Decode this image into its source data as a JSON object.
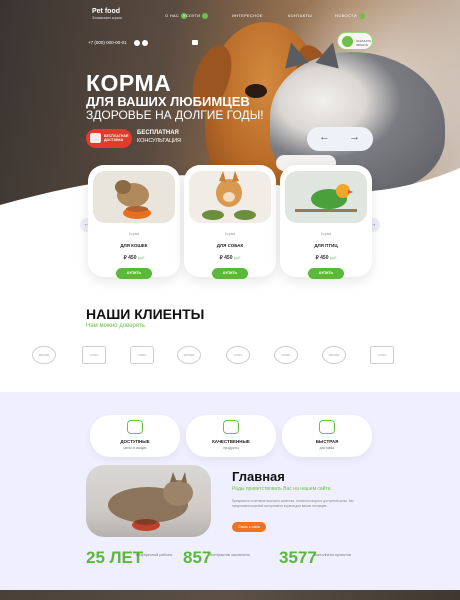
{
  "header": {
    "logo_title": "Pet food",
    "logo_sub": "Зоомагазин корма",
    "nav": [
      "О НАС",
      "УСЛУГИ",
      "ИНТЕРЕСНОЕ",
      "КОНТАКТЫ",
      "НОВОСТИ"
    ],
    "phone": "+7 (000) 000-00-01",
    "cart_label": "ЗАКАЗАТЬ ЗВОНОК"
  },
  "hero": {
    "title": "КОРМА",
    "subtitle": "ДЛЯ ВАШИХ ЛЮБИМЦЕВ",
    "tagline": "ЗДОРОВЬЕ НА ДОЛГИЕ ГОДЫ!",
    "badge_text": "БЕСПЛАТНАЯ ДОСТАВКА",
    "promo_title": "БЕСПЛАТНАЯ",
    "promo_sub": "КОНСУЛЬТАЦИЯ",
    "arrow_prev": "←",
    "arrow_next": "→"
  },
  "products": [
    {
      "brand": "Корма",
      "name": "ДЛЯ КОШЕК",
      "price": "450",
      "currency": "руб",
      "button": "КУПИТЬ"
    },
    {
      "brand": "Корма",
      "name": "ДЛЯ СОБАК",
      "price": "450",
      "currency": "руб",
      "button": "КУПИТЬ"
    },
    {
      "brand": "Корма",
      "name": "ДЛЯ ПТИЦ",
      "price": "450",
      "currency": "руб",
      "button": "КУПИТЬ"
    }
  ],
  "slider": {
    "prev": "←",
    "next": "→"
  },
  "clients": {
    "title": "НАШИ КЛИЕНТЫ",
    "subtitle": "Нам можно доверять",
    "logos": [
      "BRAND",
      "LOGO",
      "CORP",
      "BRAND",
      "LOGO",
      "FOOD",
      "BRAND",
      "LOGO"
    ]
  },
  "features": [
    {
      "title": "ДОСТУПНЫЕ",
      "sub": "цены и скидки"
    },
    {
      "title": "КАЧЕСТВЕННЫЕ",
      "sub": "продукты"
    },
    {
      "title": "БЫСТРАЯ",
      "sub": "доставка"
    }
  ],
  "about": {
    "title": "Главная",
    "subtitle": "Рады приветствовать Вас на нашем сайте.",
    "text": "Прекрасное сочетание высокого качества, отличного вкуса и доступной цены. Мы предлагаем широкий ассортимент кормов для ваших питомцев.",
    "button": "Связь с нами"
  },
  "stats": [
    {
      "value": "25 ЛЕТ",
      "label": "безупречной работы"
    },
    {
      "value": "857",
      "label": "Контрактов заключено"
    },
    {
      "value": "3577",
      "label": "Выполнено проектов"
    }
  ],
  "colors": {
    "accent_green": "#5cb83a",
    "accent_red": "#e8382c",
    "accent_orange": "#ee7322",
    "feature_bg": "#efefff"
  }
}
